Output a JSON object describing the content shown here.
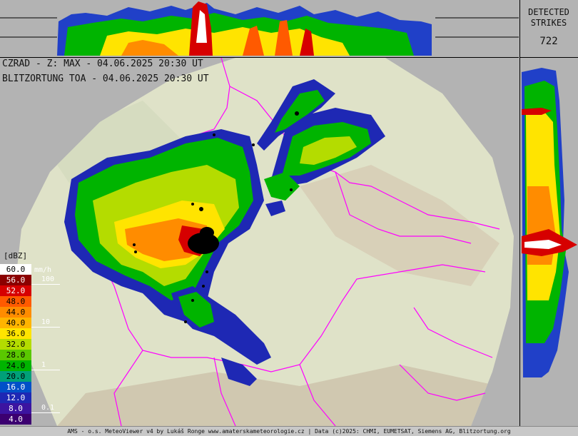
{
  "header": {
    "line1": "CZRAD - Z: MAX - 04.06.2025 20:30 UT",
    "line2": "BLITZORTUNG TOA - 04.06.2025 20:30 UT"
  },
  "strikes": {
    "title_line1": "DETECTED",
    "title_line2": "STRIKES",
    "count": "722"
  },
  "legend": {
    "unit": "[dBZ]",
    "rate_unit": "mm/h",
    "entries": [
      {
        "label": "60.0",
        "color": "#ffffff",
        "text": "#000000"
      },
      {
        "label": "56.0",
        "color": "#8b0000",
        "text": "#ffffff"
      },
      {
        "label": "52.0",
        "color": "#d60000",
        "text": "#ffffff"
      },
      {
        "label": "48.0",
        "color": "#ff5a00",
        "text": "#000000"
      },
      {
        "label": "44.0",
        "color": "#ff8c00",
        "text": "#000000"
      },
      {
        "label": "40.0",
        "color": "#ffb400",
        "text": "#000000"
      },
      {
        "label": "36.0",
        "color": "#ffe400",
        "text": "#000000"
      },
      {
        "label": "32.0",
        "color": "#b4dc00",
        "text": "#000000"
      },
      {
        "label": "28.0",
        "color": "#5ac800",
        "text": "#000000"
      },
      {
        "label": "24.0",
        "color": "#00b400",
        "text": "#000000"
      },
      {
        "label": "20.0",
        "color": "#00a078",
        "text": "#000000"
      },
      {
        "label": "16.0",
        "color": "#0050c8",
        "text": "#ffffff"
      },
      {
        "label": "12.0",
        "color": "#1e28b4",
        "text": "#ffffff"
      },
      {
        "label": "8.0",
        "color": "#3c14a0",
        "text": "#ffffff"
      },
      {
        "label": "4.0",
        "color": "#3c0070",
        "text": "#ffffff"
      }
    ],
    "rates": [
      {
        "label": "100",
        "row": 1
      },
      {
        "label": "10",
        "row": 5
      },
      {
        "label": "1",
        "row": 9
      },
      {
        "label": "0.1",
        "row": 13
      }
    ]
  },
  "footer": {
    "text": "AMS - o.s. MeteoViewer v4 by Lukáš Ronge www.amaterskameteorologie.cz | Data (c)2025: CHMI, EUMETSAT, Siemens AG, Blitzortung.org"
  },
  "colors": {
    "terrain": "#dfe2c8",
    "border": "#ff00ff",
    "background": "#b3b3b3"
  }
}
